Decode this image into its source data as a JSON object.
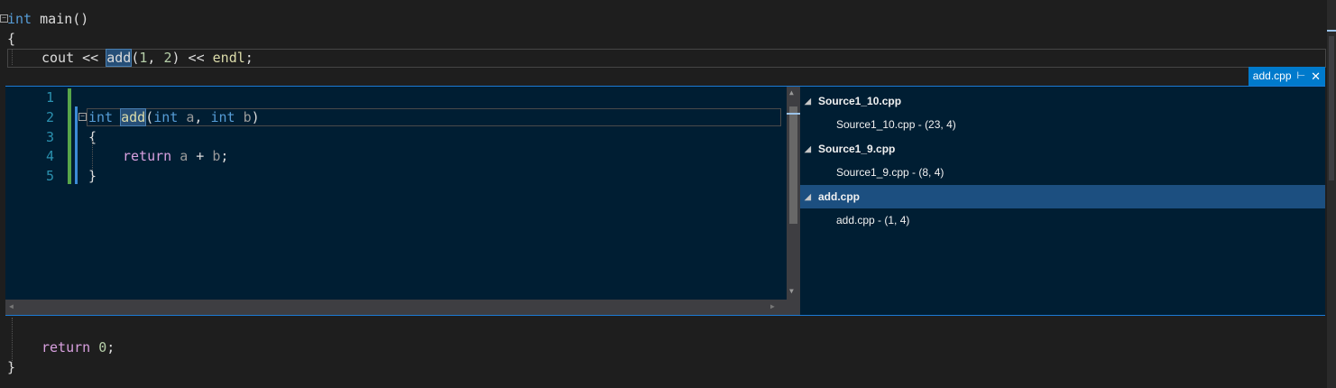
{
  "editor": {
    "line_main_kw": "int",
    "line_main_fn": " main()",
    "line_open_brace": "{",
    "line_cout_pre": "cout << ",
    "line_cout_fn": "add",
    "line_cout_args_open": "(",
    "line_cout_arg1": "1",
    "line_cout_comma": ", ",
    "line_cout_arg2": "2",
    "line_cout_post": ") << ",
    "line_cout_endl": "endl",
    "line_cout_semi": ";",
    "line_return_kw": "return",
    "line_return_val": "0",
    "line_return_semi": ";",
    "line_close_brace": "}"
  },
  "peek": {
    "tab_label": "add.cpp",
    "pin_icon": "pin-icon",
    "close_icon": "close-icon",
    "line_numbers": [
      "1",
      "2",
      "3",
      "4",
      "5"
    ],
    "code": {
      "l2_kw": "int",
      "l2_fn": "add",
      "l2_paren_open": "(",
      "l2_kw2": "int",
      "l2_param1": "a",
      "l2_comma": ", ",
      "l2_kw3": "int",
      "l2_param2": "b",
      "l2_paren_close": ")",
      "l3": "{",
      "l4_kw": "return",
      "l4_a": "a",
      "l4_plus": " + ",
      "l4_b": "b",
      "l4_semi": ";",
      "l5": "}"
    },
    "results": [
      {
        "group": "Source1_10.cpp",
        "child": "Source1_10.cpp - (23, 4)"
      },
      {
        "group": "Source1_9.cpp",
        "child": "Source1_9.cpp - (8, 4)"
      },
      {
        "group": "add.cpp",
        "child": "add.cpp - (1, 4)",
        "selected": true
      }
    ]
  },
  "colors": {
    "keyword": "#569cd6",
    "function": "#dcdcaa",
    "control": "#d8a0df",
    "number": "#b5cea8",
    "accent": "#007acc",
    "peek_background": "#001e33"
  }
}
